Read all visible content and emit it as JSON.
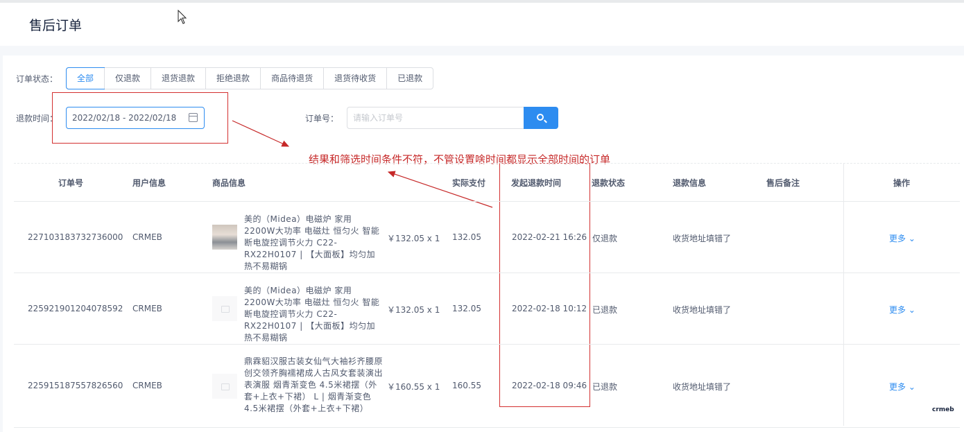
{
  "header": {
    "title": "售后订单"
  },
  "filters": {
    "status_label": "订单状态：",
    "status_tabs": [
      "全部",
      "仅退款",
      "退货退款",
      "拒绝退款",
      "商品待退货",
      "退货待收货",
      "已退款"
    ],
    "active_status": "全部",
    "time_label": "退款时间：",
    "date_range": "2022/02/18 - 2022/02/18",
    "order_label": "订单号：",
    "order_placeholder": "请输入订单号"
  },
  "annotation": "结果和筛选时间条件不符，不管设置啥时间都显示全部时间的订单",
  "table": {
    "columns": [
      "订单号",
      "用户信息",
      "商品信息",
      "实际支付",
      "发起退款时间",
      "退款状态",
      "退款信息",
      "售后备注",
      "操作"
    ],
    "rows": [
      {
        "order_no": "227103183732736000",
        "user": "CRMEB",
        "goods": "美的（Midea）电磁炉 家用2200W大功率 电磁灶 恒匀火 智能断电旋控调节火力 C22-RX22H0107 | 【大面板】均匀加热不易糊锅",
        "price_qty": "￥132.05 x 1",
        "paid": "132.05",
        "refund_time": "2022-02-21 16:26",
        "status": "仅退款",
        "refund_info": "收货地址填错了",
        "remark": "",
        "action": "更多"
      },
      {
        "order_no": "225921901204078592",
        "user": "CRMEB",
        "goods": "美的（Midea）电磁炉 家用2200W大功率 电磁灶 恒匀火 智能断电旋控调节火力 C22-RX22H0107 | 【大面板】均匀加热不易糊锅",
        "price_qty": "￥132.05 x 1",
        "paid": "132.05",
        "refund_time": "2022-02-18 10:12",
        "status": "已退款",
        "refund_info": "收货地址填错了",
        "remark": "",
        "action": "更多"
      },
      {
        "order_no": "225915187557826560",
        "user": "CRMEB",
        "goods": "鼎霖貂汉服古装女仙气大袖衫齐腰原创交领齐胸襦裙成人古风女套装演出表演服 烟青渐变色 4.5米裙摆（外套+上衣+下裙） L | 烟青渐变色 4.5米裙摆（外套+上衣+下裙）",
        "price_qty": "￥160.55 x 1",
        "paid": "160.55",
        "refund_time": "2022-02-18 09:46",
        "status": "已退款",
        "refund_info": "收货地址填错了",
        "remark": "",
        "action": "更多"
      }
    ]
  },
  "logo_text": "crmeb",
  "colors": {
    "primary": "#2d8cf0",
    "annotation_red": "#c62828",
    "border": "#dcdee2"
  }
}
